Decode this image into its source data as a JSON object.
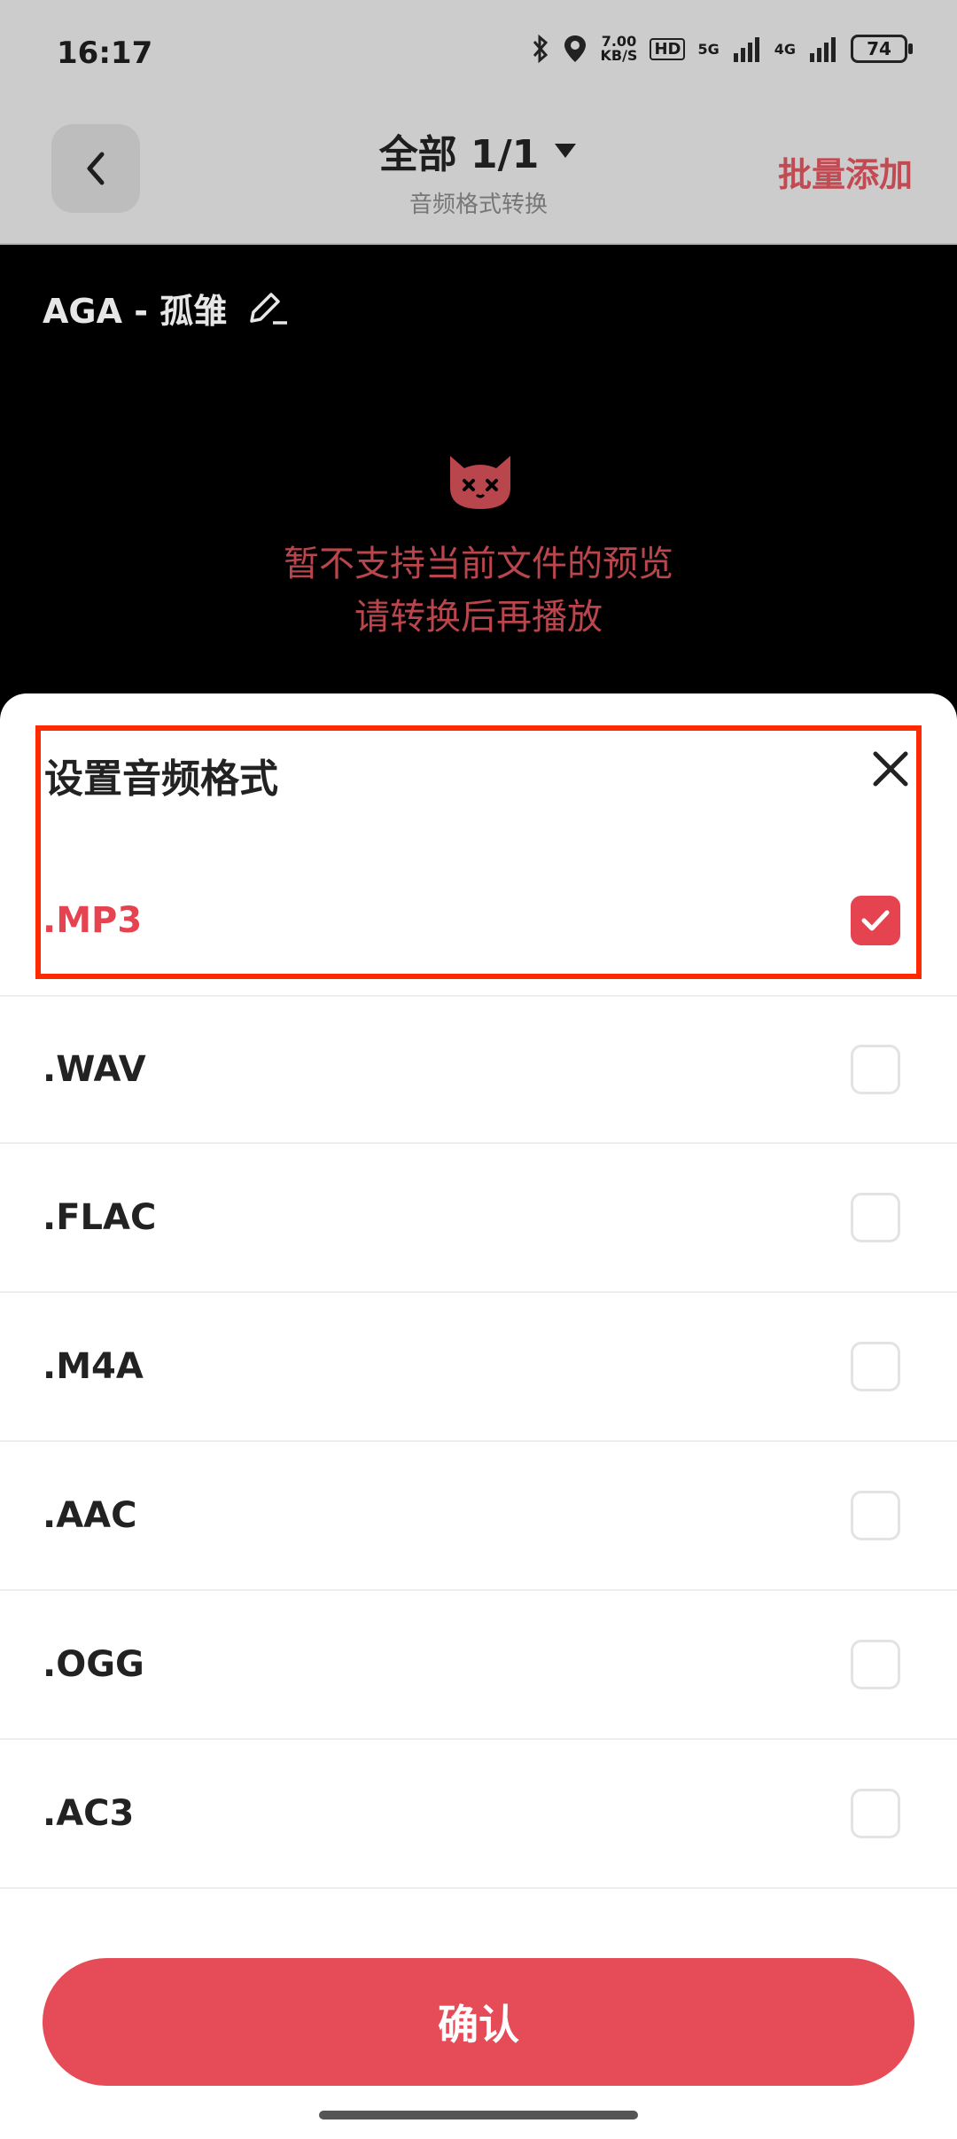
{
  "status_bar": {
    "time": "16:17",
    "speed_value": "7.00",
    "speed_unit": "KB/S",
    "hd_label": "HD",
    "net_5g": "5G",
    "net_4g": "4G",
    "battery": "74"
  },
  "header": {
    "title": "全部 1/1",
    "subtitle": "音频格式转换",
    "batch_add_label": "批量添加"
  },
  "preview": {
    "file_name": "AGA - 孤雏",
    "message_line1": "暂不支持当前文件的预览",
    "message_line2": "请转换后再播放"
  },
  "sheet": {
    "title": "设置音频格式",
    "options": [
      {
        "label": ".MP3",
        "checked": true
      },
      {
        "label": ".WAV",
        "checked": false
      },
      {
        "label": ".FLAC",
        "checked": false
      },
      {
        "label": ".M4A",
        "checked": false
      },
      {
        "label": ".AAC",
        "checked": false
      },
      {
        "label": ".OGG",
        "checked": false
      },
      {
        "label": ".AC3",
        "checked": false
      }
    ],
    "confirm_label": "确认"
  },
  "colors": {
    "accent": "#e64c58",
    "highlight_box": "#ff2a00",
    "header_bg": "#cccccc"
  }
}
